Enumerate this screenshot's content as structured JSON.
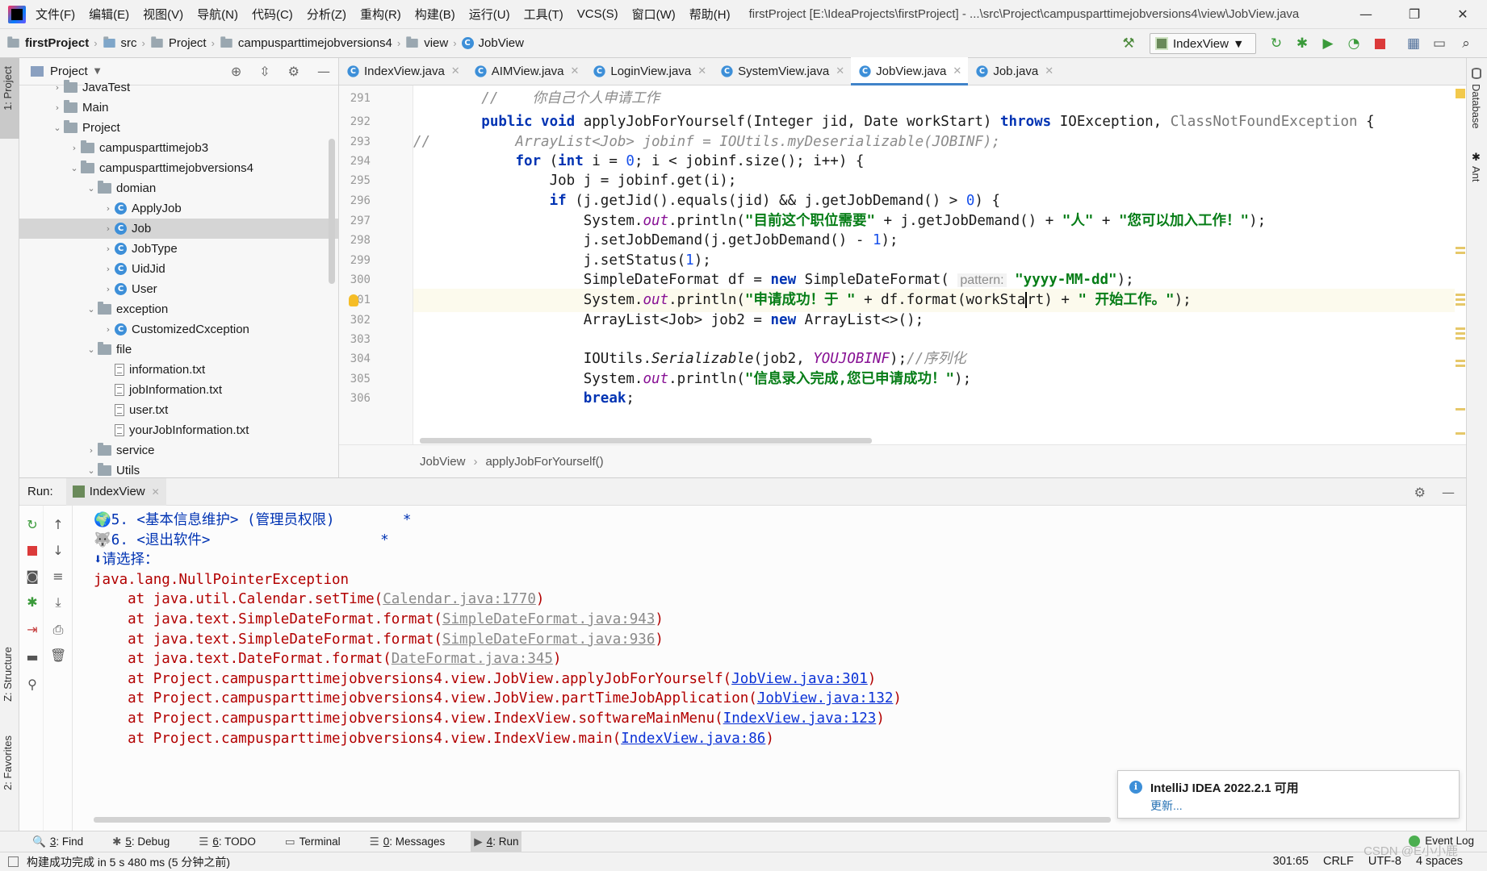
{
  "menubar": {
    "items": [
      "文件(F)",
      "编辑(E)",
      "视图(V)",
      "导航(N)",
      "代码(C)",
      "分析(Z)",
      "重构(R)",
      "构建(B)",
      "运行(U)",
      "工具(T)",
      "VCS(S)",
      "窗口(W)",
      "帮助(H)"
    ],
    "window_title": "firstProject [E:\\IdeaProjects\\firstProject] - ...\\src\\Project\\campusparttimejobversions4\\view\\JobView.java",
    "controls": [
      "—",
      "❐",
      "✕"
    ]
  },
  "breadcrumb": {
    "items": [
      "firstProject",
      "src",
      "Project",
      "campusparttimejobversions4",
      "view",
      "JobView"
    ]
  },
  "run_config": {
    "label": "IndexView"
  },
  "left_stripe": {
    "project": "1: Project",
    "structure": "Z: Structure",
    "favorites": "2: Favorites"
  },
  "right_stripe": {
    "database": "Database",
    "ant": "Ant"
  },
  "project_panel": {
    "title": "Project",
    "tree": [
      {
        "label": "JavaTest",
        "type": "folder",
        "indent": 1,
        "arrow": "›"
      },
      {
        "label": "Main",
        "type": "folder",
        "indent": 1,
        "arrow": "›"
      },
      {
        "label": "Project",
        "type": "folder",
        "indent": 1,
        "arrow": "⌄"
      },
      {
        "label": "campusparttimejob3",
        "type": "folder",
        "indent": 2,
        "arrow": "›"
      },
      {
        "label": "campusparttimejobversions4",
        "type": "folder",
        "indent": 2,
        "arrow": "⌄"
      },
      {
        "label": "domian",
        "type": "folder",
        "indent": 3,
        "arrow": "⌄"
      },
      {
        "label": "ApplyJob",
        "type": "class",
        "indent": 4,
        "arrow": "›"
      },
      {
        "label": "Job",
        "type": "class",
        "indent": 4,
        "arrow": "›",
        "selected": true
      },
      {
        "label": "JobType",
        "type": "class",
        "indent": 4,
        "arrow": "›"
      },
      {
        "label": "UidJid",
        "type": "class",
        "indent": 4,
        "arrow": "›"
      },
      {
        "label": "User",
        "type": "class",
        "indent": 4,
        "arrow": "›"
      },
      {
        "label": "exception",
        "type": "folder",
        "indent": 3,
        "arrow": "⌄"
      },
      {
        "label": "CustomizedCxception",
        "type": "class",
        "indent": 4,
        "arrow": "›"
      },
      {
        "label": "file",
        "type": "folder",
        "indent": 3,
        "arrow": "⌄"
      },
      {
        "label": "information.txt",
        "type": "file",
        "indent": 4,
        "arrow": ""
      },
      {
        "label": "jobInformation.txt",
        "type": "file",
        "indent": 4,
        "arrow": ""
      },
      {
        "label": "user.txt",
        "type": "file",
        "indent": 4,
        "arrow": ""
      },
      {
        "label": "yourJobInformation.txt",
        "type": "file",
        "indent": 4,
        "arrow": ""
      },
      {
        "label": "service",
        "type": "folder",
        "indent": 3,
        "arrow": "›"
      },
      {
        "label": "Utils",
        "type": "folder",
        "indent": 3,
        "arrow": "⌄"
      }
    ]
  },
  "editor": {
    "tabs": [
      {
        "label": "IndexView.java",
        "active": false
      },
      {
        "label": "AIMView.java",
        "active": false
      },
      {
        "label": "LoginView.java",
        "active": false
      },
      {
        "label": "SystemView.java",
        "active": false
      },
      {
        "label": "JobView.java",
        "active": true
      },
      {
        "label": "Job.java",
        "active": false
      }
    ],
    "line_numbers": [
      "291",
      "292",
      "293",
      "294",
      "295",
      "296",
      "297",
      "298",
      "299",
      "300",
      "301",
      "302",
      "303",
      "304",
      "305",
      "306"
    ],
    "breadcrumb": [
      "JobView",
      "applyJobForYourself()"
    ]
  },
  "run_panel": {
    "label": "Run:",
    "tab": "IndexView",
    "console": [
      {
        "kind": "menu",
        "text": "🌍5. <基本信息维护> (管理员权限)        *"
      },
      {
        "kind": "menu",
        "text": "🐺6. <退出软件>                    *"
      },
      {
        "kind": "menu",
        "text": "⬇请选择："
      },
      {
        "kind": "err",
        "text": "java.lang.NullPointerException"
      },
      {
        "kind": "trace",
        "prefix": "\tat java.util.Calendar.setTime(",
        "link": "Calendar.java:1770",
        "suffix": ")",
        "linkstyle": "gray"
      },
      {
        "kind": "trace",
        "prefix": "\tat java.text.SimpleDateFormat.format(",
        "link": "SimpleDateFormat.java:943",
        "suffix": ")",
        "linkstyle": "gray"
      },
      {
        "kind": "trace",
        "prefix": "\tat java.text.SimpleDateFormat.format(",
        "link": "SimpleDateFormat.java:936",
        "suffix": ")",
        "linkstyle": "gray"
      },
      {
        "kind": "trace",
        "prefix": "\tat java.text.DateFormat.format(",
        "link": "DateFormat.java:345",
        "suffix": ")",
        "linkstyle": "gray"
      },
      {
        "kind": "trace",
        "prefix": "\tat Project.campusparttimejobversions4.view.JobView.applyJobForYourself(",
        "link": "JobView.java:301",
        "suffix": ")",
        "linkstyle": "blue"
      },
      {
        "kind": "trace",
        "prefix": "\tat Project.campusparttimejobversions4.view.JobView.partTimeJobApplication(",
        "link": "JobView.java:132",
        "suffix": ")",
        "linkstyle": "blue"
      },
      {
        "kind": "trace",
        "prefix": "\tat Project.campusparttimejobversions4.view.IndexView.softwareMainMenu(",
        "link": "IndexView.java:123",
        "suffix": ")",
        "linkstyle": "blue"
      },
      {
        "kind": "trace",
        "prefix": "\tat Project.campusparttimejobversions4.view.IndexView.main(",
        "link": "IndexView.java:86",
        "suffix": ")",
        "linkstyle": "blue"
      }
    ]
  },
  "notification": {
    "title": "IntelliJ IDEA 2022.2.1 可用",
    "link": "更新..."
  },
  "tool_tabs": [
    {
      "key": "3",
      "label": ": Find",
      "glyph": "🔍"
    },
    {
      "key": "5",
      "label": ": Debug",
      "glyph": "✱"
    },
    {
      "key": "6",
      "label": ": TODO",
      "glyph": "☰"
    },
    {
      "key": "",
      "label": "Terminal",
      "glyph": "▭"
    },
    {
      "key": "0",
      "label": ": Messages",
      "glyph": "☰"
    },
    {
      "key": "4",
      "label": ": Run",
      "glyph": "▶",
      "active": true
    }
  ],
  "event_log": "Event Log",
  "status": {
    "message": "构建成功完成 in 5 s 480 ms (5 分钟之前)",
    "position": "301:65",
    "line_sep": "CRLF",
    "encoding": "UTF-8",
    "indent": "4 spaces"
  },
  "watermark": "CSDN @E小小鹿"
}
